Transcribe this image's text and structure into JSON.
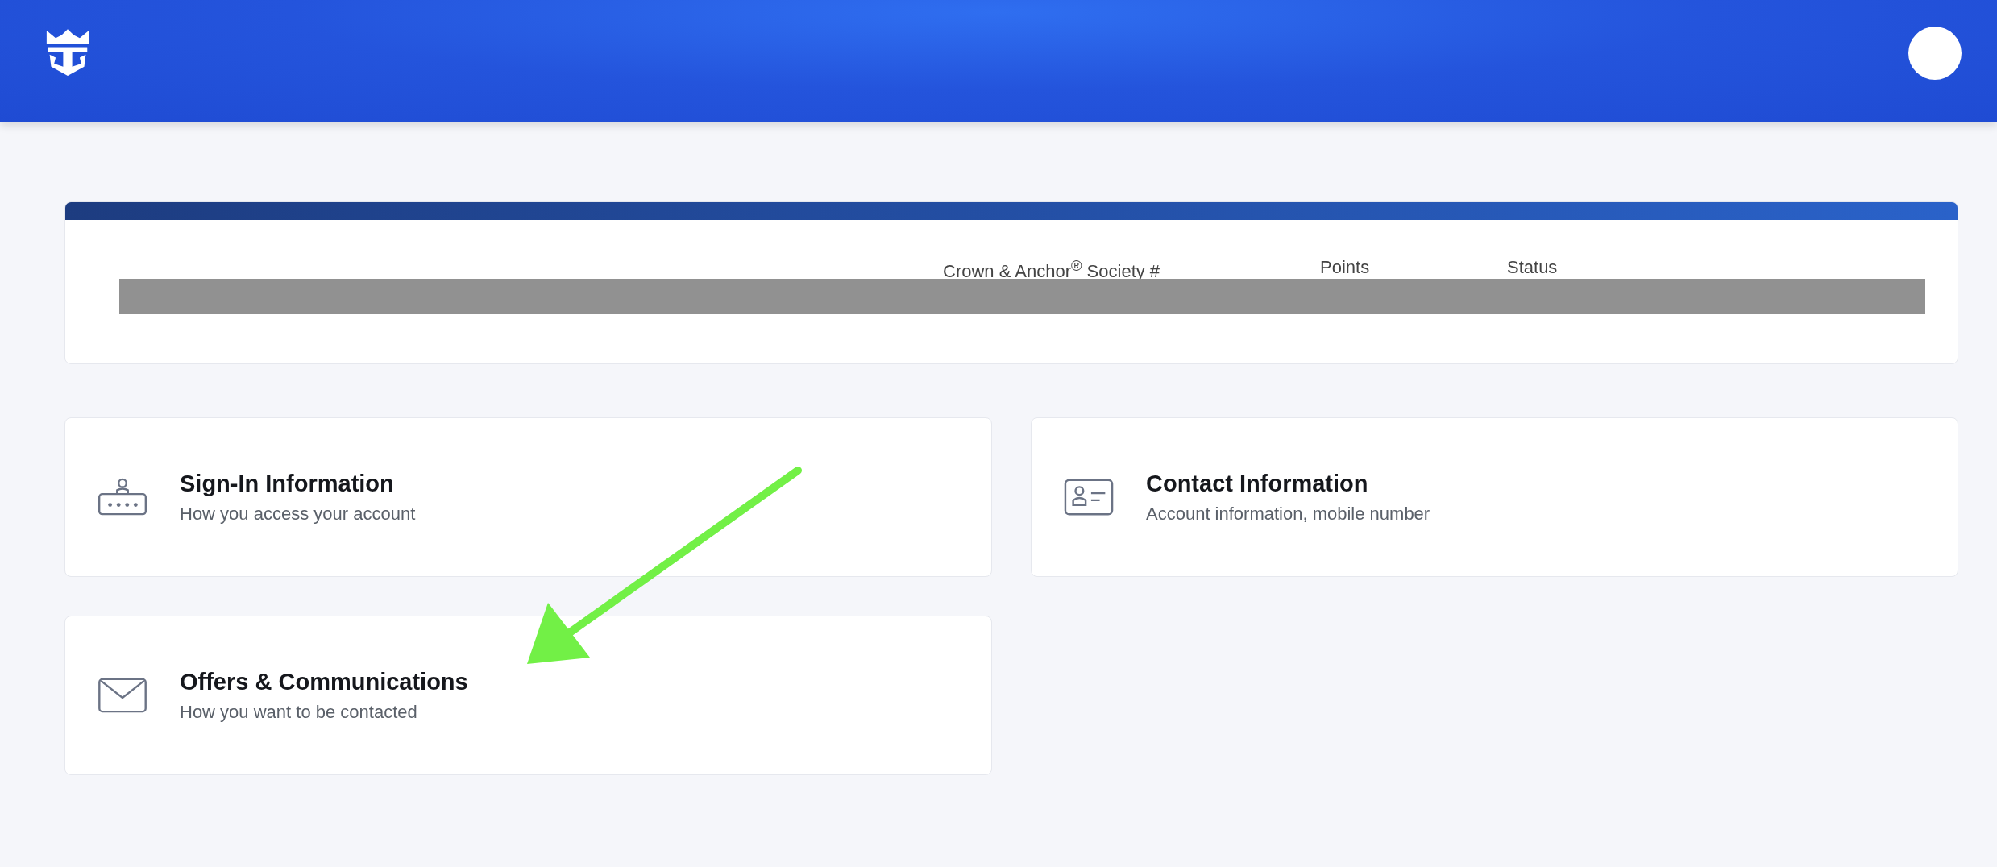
{
  "header": {
    "logo": {
      "kind": "crown-anchor"
    },
    "avatar": {
      "kind": "circle"
    }
  },
  "profile": {
    "fields": [
      {
        "label": "Crown & Anchor$^{®}$ Society #"
      },
      {
        "label": "Points"
      },
      {
        "label": "Status"
      }
    ],
    "redacted": true
  },
  "cards": [
    {
      "kind": "sign-in",
      "title": "Sign-In Information",
      "subtitle": "How you access your account"
    },
    {
      "kind": "contact",
      "title": "Contact Information",
      "subtitle": "Account information, mobile number"
    },
    {
      "kind": "mail",
      "title": "Offers & Communications",
      "subtitle": "How you want to be contacted"
    }
  ],
  "annotations": [
    {
      "kind": "arrow"
    }
  ]
}
